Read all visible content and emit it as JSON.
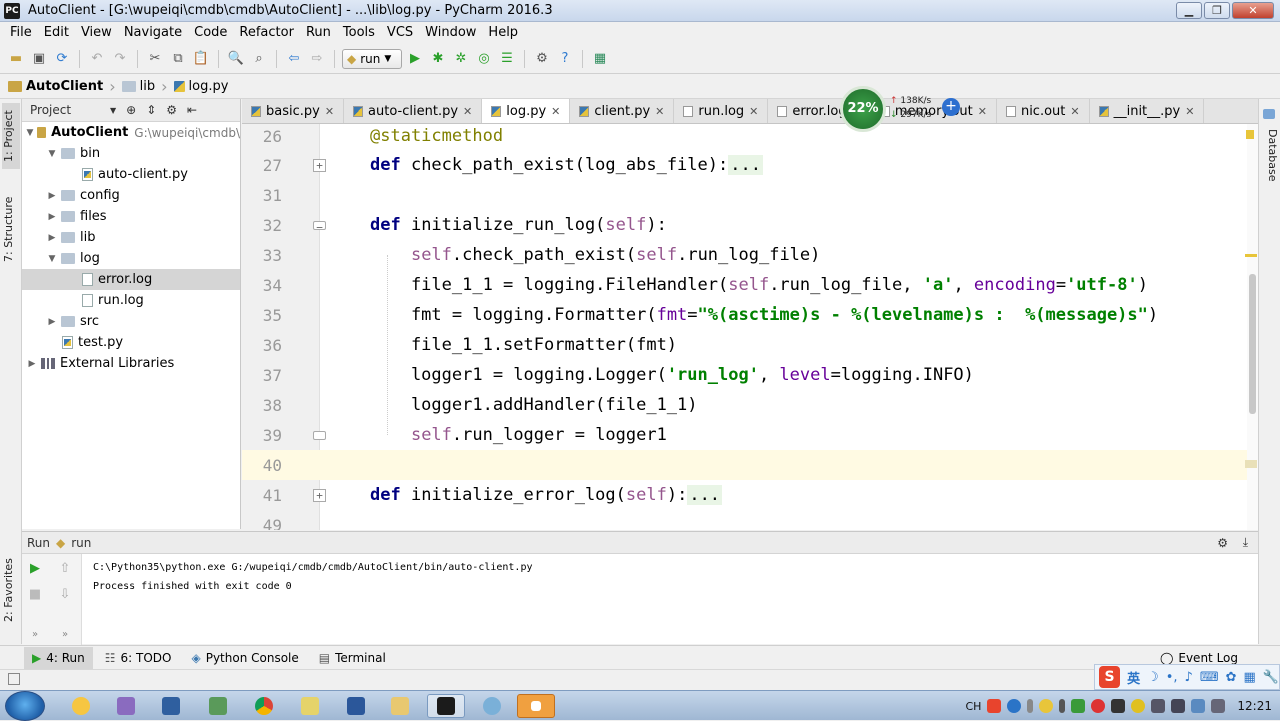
{
  "window": {
    "title": "AutoClient - [G:\\wupeiqi\\cmdb\\cmdb\\AutoClient] - ...\\lib\\log.py - PyCharm 2016.3",
    "app_icon": "PC"
  },
  "menu": [
    "File",
    "Edit",
    "View",
    "Navigate",
    "Code",
    "Refactor",
    "Run",
    "Tools",
    "VCS",
    "Window",
    "Help"
  ],
  "toolbar": {
    "run_config": "run"
  },
  "breadcrumb": [
    "AutoClient",
    "lib",
    "log.py"
  ],
  "left_strip": {
    "project_tab": "1: Project",
    "structure_tab": "7: Structure",
    "favorites_tab": "2: Favorites"
  },
  "right_strip": {
    "database_tab": "Database"
  },
  "project_panel": {
    "header": "Project",
    "tree": [
      {
        "label": "AutoClient",
        "path": "G:\\wupeiqi\\cmdb\\",
        "type": "root",
        "depth": 0,
        "expanded": true
      },
      {
        "label": "bin",
        "type": "folder",
        "depth": 1,
        "expanded": true
      },
      {
        "label": "auto-client.py",
        "type": "py",
        "depth": 2
      },
      {
        "label": "config",
        "type": "folder",
        "depth": 1,
        "expanded": false
      },
      {
        "label": "files",
        "type": "folder",
        "depth": 1,
        "expanded": false
      },
      {
        "label": "lib",
        "type": "folder",
        "depth": 1,
        "expanded": false
      },
      {
        "label": "log",
        "type": "folder",
        "depth": 1,
        "expanded": true
      },
      {
        "label": "error.log",
        "type": "file",
        "depth": 2,
        "selected": true
      },
      {
        "label": "run.log",
        "type": "file",
        "depth": 2
      },
      {
        "label": "src",
        "type": "folder",
        "depth": 1,
        "expanded": false
      },
      {
        "label": "test.py",
        "type": "py",
        "depth": 1
      },
      {
        "label": "External Libraries",
        "type": "lib",
        "depth": 0,
        "expanded": false
      }
    ]
  },
  "tabs": [
    {
      "label": "basic.py",
      "active": false
    },
    {
      "label": "auto-client.py",
      "active": false
    },
    {
      "label": "log.py",
      "active": true
    },
    {
      "label": "client.py",
      "active": false
    },
    {
      "label": "run.log",
      "active": false
    },
    {
      "label": "error.log",
      "active": false
    },
    {
      "label": "memory.out",
      "active": false
    },
    {
      "label": "nic.out",
      "active": false
    },
    {
      "label": "__init__.py",
      "active": false
    }
  ],
  "network_widget": {
    "percent": "22%",
    "up": "138K/s",
    "down": "297K/s"
  },
  "editor": {
    "lines": [
      {
        "num": "26",
        "html": "<span class=\"dec\">@staticmethod</span>"
      },
      {
        "num": "27",
        "html": "<span class=\"kw\">def</span> check_path_exist(log_abs_file):<span class=\"fold-txt\">...</span>",
        "fold": "+"
      },
      {
        "num": "31",
        "html": ""
      },
      {
        "num": "32",
        "html": "<span class=\"kw\">def</span> initialize_run_log(<span class=\"self\">self</span>):",
        "fold": "-"
      },
      {
        "num": "33",
        "html": "    <span class=\"self\">self</span>.check_path_exist(<span class=\"self\">self</span>.run_log_file)"
      },
      {
        "num": "34",
        "html": "    file_1_1 = logging.FileHandler(<span class=\"self\">self</span>.run_log_file, <span class=\"str\">'a'</span>, <span class=\"param\">encoding</span>=<span class=\"str\">'utf-8'</span>)"
      },
      {
        "num": "35",
        "html": "    fmt = logging.Formatter(<span class=\"param\">fmt</span>=<span class=\"str\">\"%(asctime)s - %(levelname)s :  %(message)s\"</span>)"
      },
      {
        "num": "36",
        "html": "    file_1_1.setFormatter(fmt)"
      },
      {
        "num": "37",
        "html": "    logger1 = logging.Logger(<span class=\"str\">'run_log'</span>, <span class=\"param\">level</span>=logging.INFO)"
      },
      {
        "num": "38",
        "html": "    logger1.addHandler(file_1_1)"
      },
      {
        "num": "39",
        "html": "    <span class=\"self\">self</span>.run_logger = logger1",
        "fold": "end"
      },
      {
        "num": "40",
        "html": "",
        "current": true
      },
      {
        "num": "41",
        "html": "<span class=\"kw\">def</span> initialize_error_log(<span class=\"self\">self</span>):<span class=\"fold-txt\">...</span>",
        "fold": "+"
      },
      {
        "num": "49",
        "html": ""
      }
    ]
  },
  "run_panel": {
    "title": "Run",
    "config": "run",
    "console": [
      "C:\\Python35\\python.exe G:/wupeiqi/cmdb/cmdb/AutoClient/bin/auto-client.py",
      "",
      "Process finished with exit code 0"
    ]
  },
  "bottom_tabs": [
    {
      "label": "4: Run",
      "active": true,
      "icon": "run-icon"
    },
    {
      "label": "6: TODO",
      "active": false,
      "icon": "todo-icon"
    },
    {
      "label": "Python Console",
      "active": false,
      "icon": "python-console-icon"
    },
    {
      "label": "Terminal",
      "active": false,
      "icon": "terminal-icon"
    }
  ],
  "event_log": "Event Log",
  "ime": {
    "lang": "英"
  },
  "taskbar": {
    "clock": "12:21",
    "locale": "CH"
  }
}
